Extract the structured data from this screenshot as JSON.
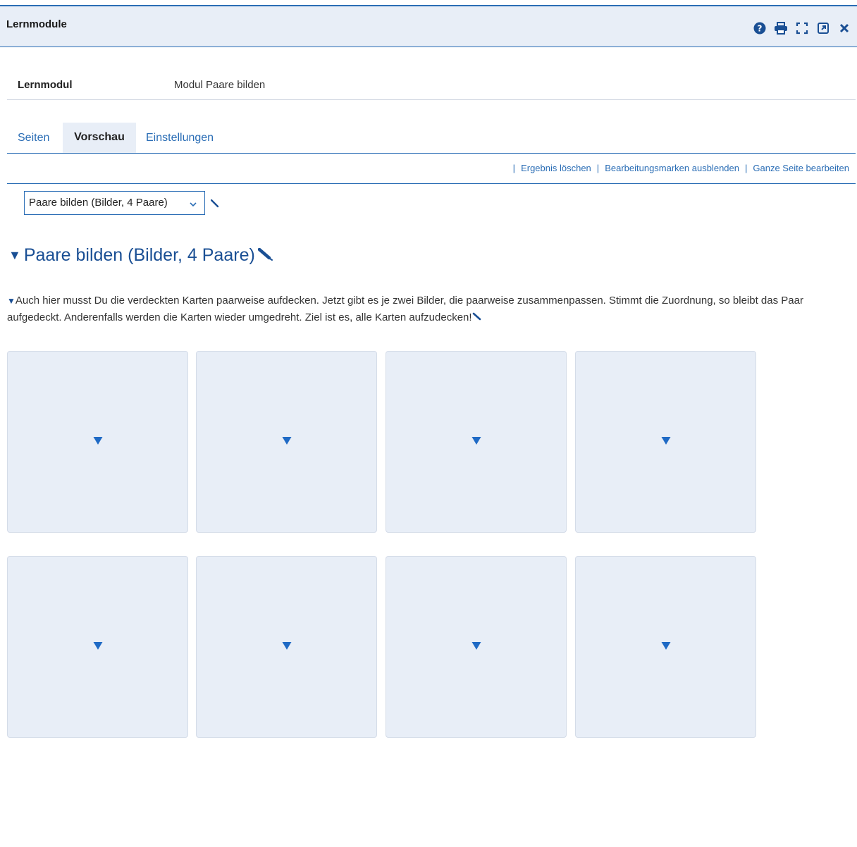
{
  "window": {
    "title": "Lernmodule",
    "icons": [
      "help-icon",
      "print-icon",
      "fullscreen-icon",
      "external-open-icon",
      "close-icon"
    ]
  },
  "meta": {
    "label": "Lernmodul",
    "value": "Modul Paare bilden"
  },
  "tabs": [
    {
      "label": "Seiten",
      "active": false
    },
    {
      "label": "Vorschau",
      "active": true
    },
    {
      "label": "Einstellungen",
      "active": false
    }
  ],
  "actions": {
    "sep": "|",
    "items": [
      "Ergebnis löschen",
      "Bearbeitungsmarken ausblenden",
      "Ganze Seite bearbeiten"
    ]
  },
  "page_select": {
    "value": "Paare bilden (Bilder, 4 Paare)"
  },
  "content": {
    "heading": "Paare bilden (Bilder, 4 Paare)",
    "description": "Auch hier musst Du die verdeckten Karten paarweise aufdecken. Jetzt gibt es je zwei Bilder, die paarweise zusammenpassen. Stimmt die Zuordnung, so bleibt das Paar aufgedeckt. Anderenfalls werden die Karten wieder umgedreht. Ziel ist es, alle Karten aufzudecken!"
  },
  "colors": {
    "accent": "#2a6db5",
    "card_bg": "#e8eef7",
    "heading": "#1a4f94"
  },
  "cards": {
    "count": 8,
    "state": "covered"
  }
}
